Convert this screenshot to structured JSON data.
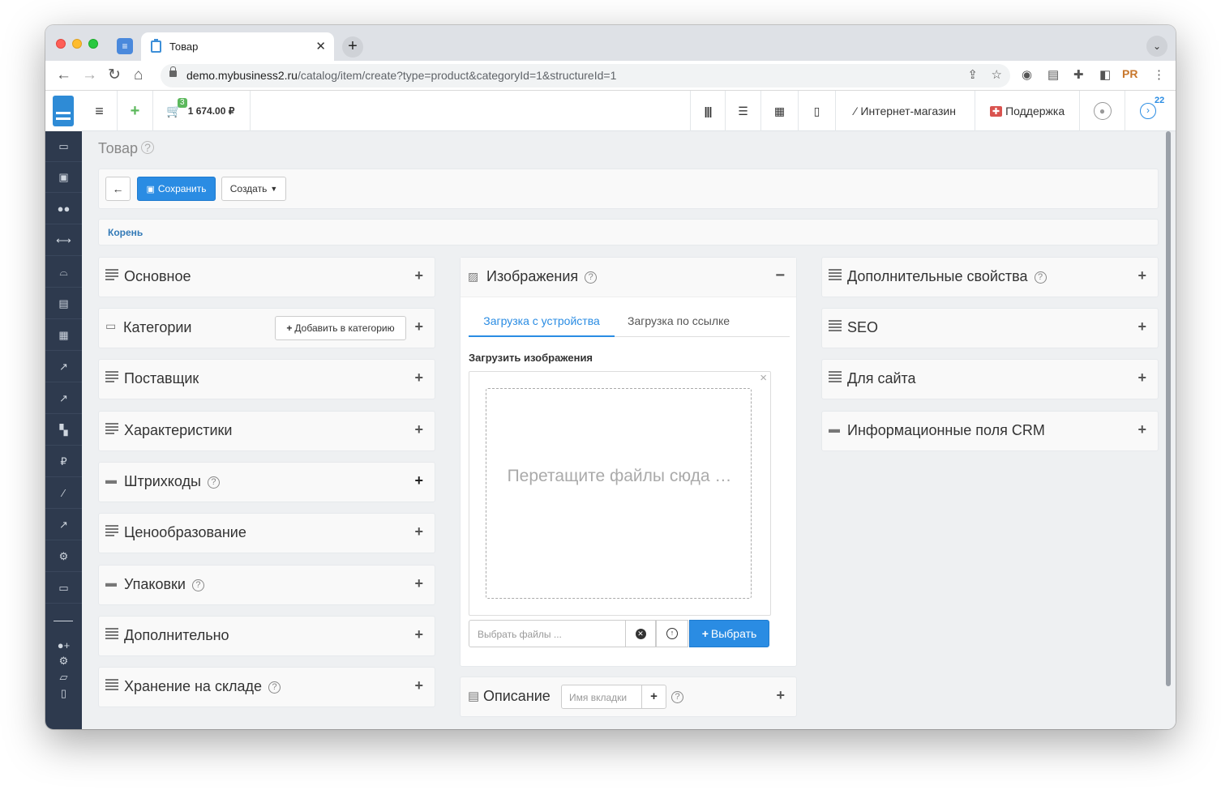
{
  "browser": {
    "tab_title": "Товар",
    "close_glyph": "✕",
    "newtab_glyph": "+",
    "url_domain": "demo.mybusiness2.ru",
    "url_path": "/catalog/item/create?type=product&categoryId=1&structureId=1"
  },
  "topbar": {
    "cart_count": "3",
    "cart_total": "1 674.00 ₽",
    "shop_label": "Интернет-магазин",
    "support_label": "Поддержка",
    "notif_count": "22"
  },
  "page": {
    "title": "Товар",
    "save_label": "Сохранить",
    "create_label": "Создать",
    "breadcrumb": "Корень"
  },
  "left_panels": [
    {
      "label": "Основное"
    },
    {
      "label": "Категории",
      "button": "Добавить в категорию"
    },
    {
      "label": "Поставщик"
    },
    {
      "label": "Характеристики"
    },
    {
      "label": "Штрихкоды"
    },
    {
      "label": "Ценообразование"
    },
    {
      "label": "Упаковки"
    },
    {
      "label": "Дополнительно"
    },
    {
      "label": "Хранение на складе"
    }
  ],
  "images": {
    "title": "Изображения",
    "tab_device": "Загрузка с устройства",
    "tab_link": "Загрузка по ссылке",
    "upload_label": "Загрузить изображения",
    "drop_text": "Перетащите файлы сюда …",
    "file_placeholder": "Выбрать файлы ...",
    "choose_label": "Выбрать"
  },
  "description": {
    "title": "Описание",
    "tab_placeholder": "Имя вкладки"
  },
  "right_panels": [
    {
      "label": "Дополнительные свойства"
    },
    {
      "label": "SEO"
    },
    {
      "label": "Для сайта"
    },
    {
      "label": "Информационные поля CRM"
    }
  ],
  "colors": {
    "primary": "#2a8ce3",
    "sidebar": "#2e3a4e"
  }
}
